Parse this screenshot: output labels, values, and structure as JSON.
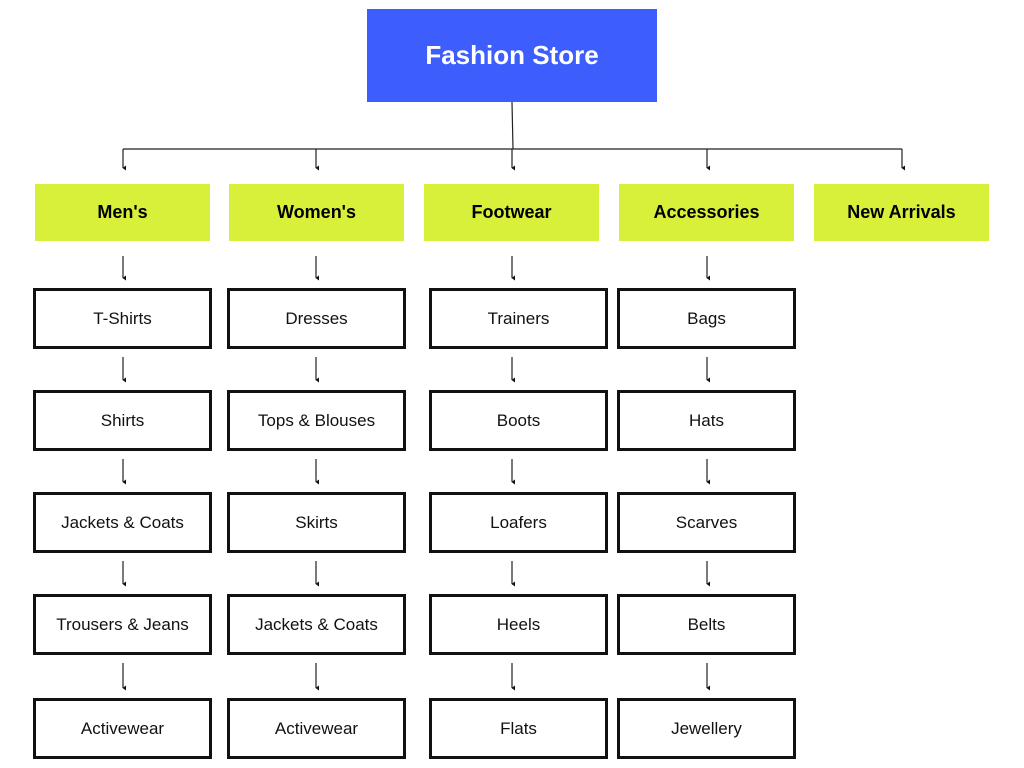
{
  "root": {
    "label": "Fashion Store",
    "color": "#3d5efd"
  },
  "category_color": "#d8f03a",
  "categories": [
    {
      "label": "Men's",
      "items": [
        "T-Shirts",
        "Shirts",
        "Jackets & Coats",
        "Trousers & Jeans",
        "Activewear"
      ]
    },
    {
      "label": "Women's",
      "items": [
        "Dresses",
        "Tops & Blouses",
        "Skirts",
        "Jackets & Coats",
        "Activewear"
      ]
    },
    {
      "label": "Footwear",
      "items": [
        "Trainers",
        "Boots",
        "Loafers",
        "Heels",
        "Flats"
      ]
    },
    {
      "label": "Accessories",
      "items": [
        "Bags",
        "Hats",
        "Scarves",
        "Belts",
        "Jewellery"
      ]
    },
    {
      "label": "New Arrivals",
      "items": []
    }
  ]
}
